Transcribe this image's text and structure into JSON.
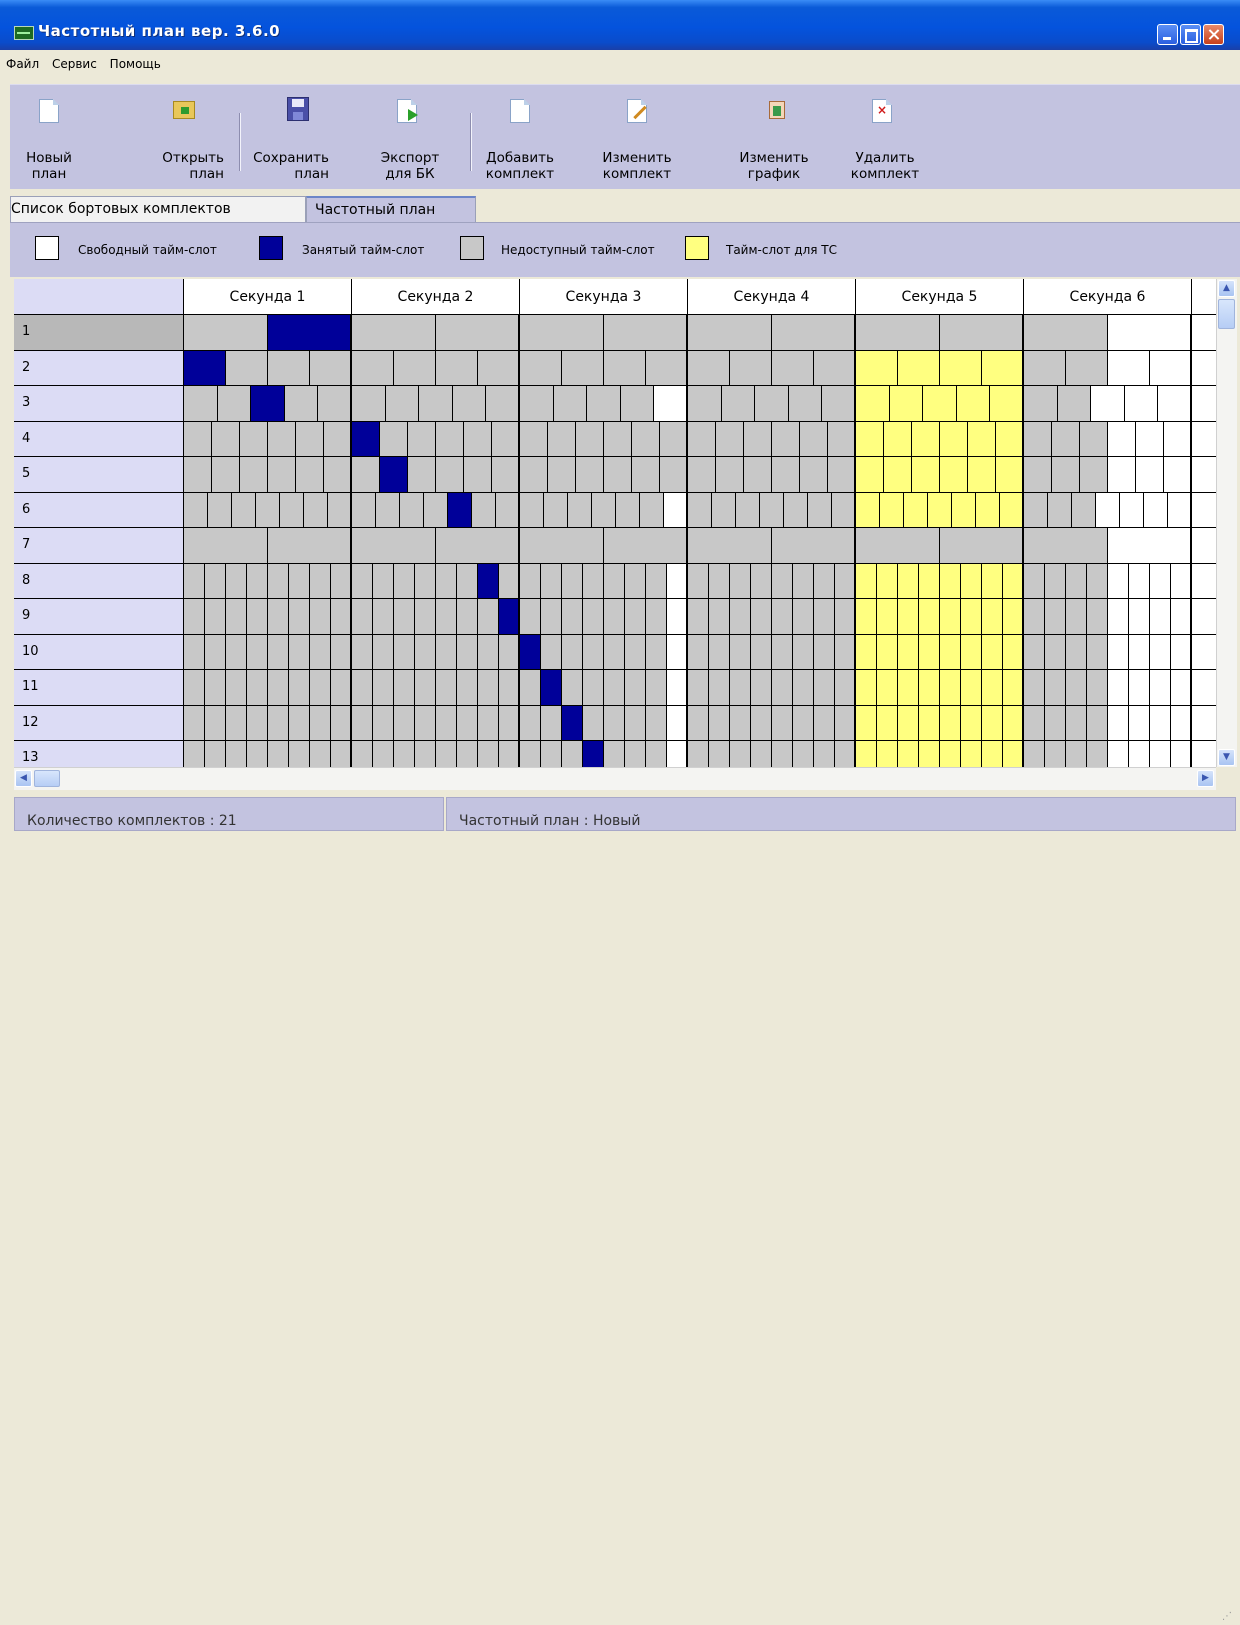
{
  "window": {
    "title": "Частотный план  вер. 3.6.0"
  },
  "menu": [
    "Файл",
    "Сервис",
    "Помощь"
  ],
  "toolbar": [
    {
      "label": "Новый\nплан",
      "icon": "new-document-icon"
    },
    {
      "label": "Открыть\n   план",
      "icon": "open-folder-icon"
    },
    {
      "label": "Сохранить\n   план",
      "icon": "save-floppy-icon"
    },
    {
      "label": "Экспорт\nдля БК",
      "icon": "export-arrow-icon"
    },
    {
      "label": "Добавить\nкомплект",
      "icon": "add-document-icon"
    },
    {
      "label": "Изменить\nкомплект",
      "icon": "edit-pencil-icon"
    },
    {
      "label": "Изменить\nграфик",
      "icon": "chart-edit-icon"
    },
    {
      "label": "Удалить\nкомплект",
      "icon": "delete-red-x-icon"
    }
  ],
  "tabs": [
    {
      "label": "Список бортовых комплектов",
      "active": false
    },
    {
      "label": "Частотный план",
      "active": true
    }
  ],
  "legend": [
    {
      "label": "Свободный тайм-слот",
      "color": "#ffffff"
    },
    {
      "label": "Занятый тайм-слот",
      "color": "#000099"
    },
    {
      "label": "Недоступный тайм-слот",
      "color": "#c8c8c8"
    },
    {
      "label": "Тайм-слот для ТС",
      "color": "#ffff80"
    }
  ],
  "grid": {
    "column_headers": [
      "Секунда 1",
      "Секунда 2",
      "Секунда 3",
      "Секунда 4",
      "Секунда 5",
      "Секунда 6"
    ],
    "row_labels": [
      "1",
      "2",
      "3",
      "4",
      "5",
      "6",
      "7",
      "8",
      "9",
      "10",
      "11",
      "12",
      "13"
    ],
    "selected_row": "1",
    "colors": {
      "free": "#ffffff",
      "busy": "#000099",
      "unavailable": "#c8c8c8",
      "tc": "#ffff80"
    }
  },
  "status": {
    "count_label": "Количество комплектов : 21",
    "plan_label": "Частотный план : Новый"
  }
}
